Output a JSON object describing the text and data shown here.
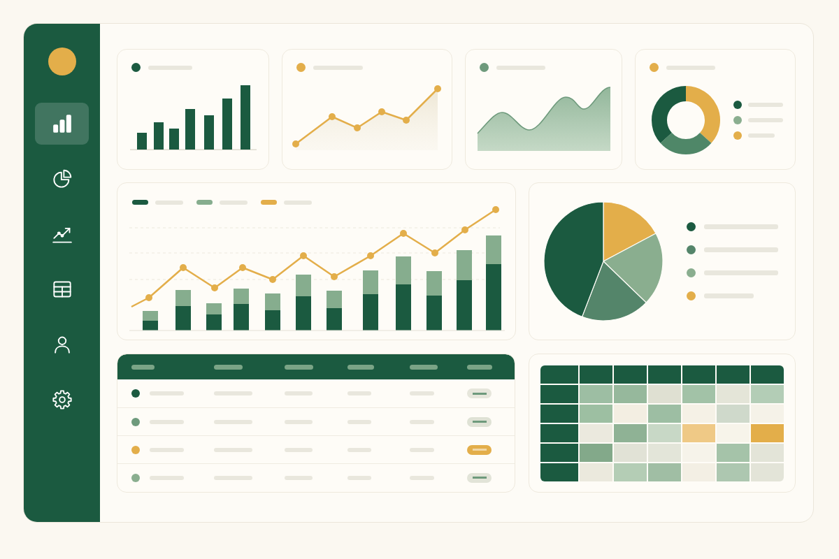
{
  "sidebar": {
    "items": [
      {
        "selected": true
      },
      {
        "selected": false
      },
      {
        "selected": false
      },
      {
        "selected": false
      },
      {
        "selected": false
      },
      {
        "selected": false
      }
    ]
  },
  "summary_cards": [
    {
      "kind": "bar",
      "color": "#1b5a40"
    },
    {
      "kind": "line",
      "color": "#e3ae4a"
    },
    {
      "kind": "area",
      "color": "#6e9a7c"
    },
    {
      "kind": "donut",
      "color": "#e3ae4a",
      "legend": [
        {
          "color": "#1b5a40"
        },
        {
          "color": "#8aae8f"
        },
        {
          "color": "#e3ae4a"
        }
      ]
    }
  ],
  "combo_chart": {
    "legend": [
      {
        "color": "#1b5a40"
      },
      {
        "color": "#86ad8e"
      },
      {
        "color": "#e3ae4a"
      }
    ]
  },
  "pie_chart": {
    "legend": [
      {
        "color": "#1b5a40"
      },
      {
        "color": "#54856a"
      },
      {
        "color": "#8aae8f"
      },
      {
        "color": "#e3ae4a"
      }
    ]
  },
  "table": {
    "rows": [
      {
        "color": "#1b5a40",
        "tag": {
          "color": "#e6e6db"
        }
      },
      {
        "color": "#6e9a7c",
        "tag": {
          "color": "#dfe2d5"
        }
      },
      {
        "color": "#e3ae4a",
        "tag": {
          "color": "#e3ae4a"
        }
      },
      {
        "color": "#8aae8f",
        "tag": {
          "color": "#e2e4d8"
        }
      }
    ]
  },
  "heatmap": {
    "rows": [
      {
        "cells": [
          {
            "color": "#9dbea3"
          },
          {
            "color": "#96b89c"
          },
          {
            "color": "#dfe0d2"
          },
          {
            "color": "#a2c2a7"
          },
          {
            "color": "#e4e5d8"
          },
          {
            "color": "#b3cdb6"
          }
        ]
      },
      {
        "cells": [
          {
            "color": "#9dbfa2"
          },
          {
            "color": "#f3eee2"
          },
          {
            "color": "#9dbea3"
          },
          {
            "color": "#f5f1e6"
          },
          {
            "color": "#cfd9cb"
          },
          {
            "color": "#f5f2e8"
          }
        ]
      },
      {
        "cells": [
          {
            "color": "#ebe9de"
          },
          {
            "color": "#8fb295"
          },
          {
            "color": "#c8d8c6"
          },
          {
            "color": "#efc986"
          },
          {
            "color": "#f7f4ea"
          },
          {
            "color": "#e3ae4a"
          }
        ]
      },
      {
        "cells": [
          {
            "color": "#83a98a"
          },
          {
            "color": "#e1e2d6"
          },
          {
            "color": "#e3e5d9"
          },
          {
            "color": "#f6f3ea"
          },
          {
            "color": "#a5c3a9"
          },
          {
            "color": "#e3e4d8"
          }
        ]
      },
      {
        "cells": [
          {
            "color": "#ebe9dd"
          },
          {
            "color": "#b4cdb5"
          },
          {
            "color": "#a0bea4"
          },
          {
            "color": "#f3efe4"
          },
          {
            "color": "#adc7b0"
          },
          {
            "color": "#e3e4d8"
          }
        ]
      }
    ]
  }
}
